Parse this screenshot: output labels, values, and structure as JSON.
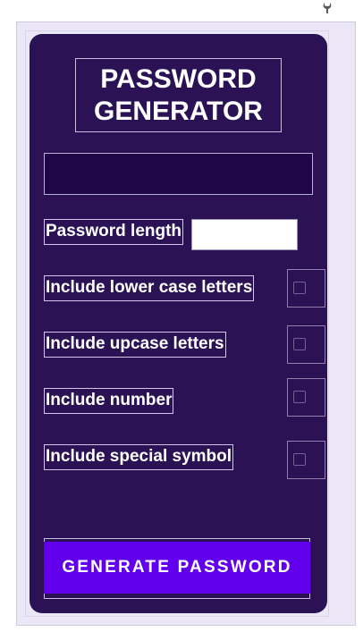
{
  "toolbar": {
    "icon": "wrench-icon"
  },
  "app": {
    "title_line1": "PASSWORD",
    "title_line2": "GENERATOR",
    "password_display": ""
  },
  "options": {
    "length_label": "Password length",
    "length_value": "",
    "lowercase_label": "Include lower case letters",
    "lowercase_checked": false,
    "uppercase_label": "Include upcase letters",
    "uppercase_checked": false,
    "number_label": "Include number",
    "number_checked": false,
    "symbol_label": "Include special symbol",
    "symbol_checked": false
  },
  "actions": {
    "generate_label": "GENERATE PASSWORD"
  },
  "colors": {
    "card_background": "#2a1255",
    "display_background": "#1d0745",
    "button_accent": "#6200ee",
    "outer_frame": "#ebe7f7"
  }
}
